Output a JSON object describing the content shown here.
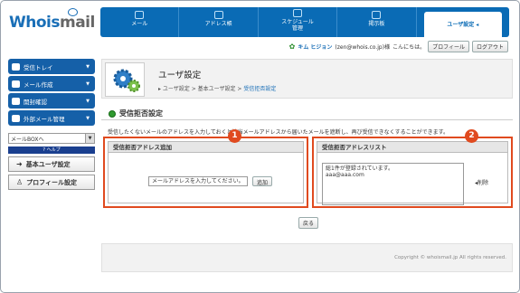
{
  "logo": {
    "part1": "Whois",
    "part2": "mail"
  },
  "nav": [
    {
      "label": "メール",
      "icon": "mail-icon"
    },
    {
      "label": "アドレス帳",
      "icon": "address-book-icon"
    },
    {
      "label": "スケジュール",
      "label2": "管理",
      "icon": "schedule-icon"
    },
    {
      "label": "掲示板",
      "icon": "board-icon"
    },
    {
      "label": "ユーザ設定 ◂",
      "icon": "settings-icon"
    }
  ],
  "userbar": {
    "name": "キム ヒジョン",
    "email": "(zen@whois.co.jp)様",
    "greeting": "こんにちは。",
    "profile": "プロフィール",
    "logout": "ログアウト"
  },
  "sidebar": {
    "menus": [
      "受信トレイ",
      "メール作成",
      "開封確認",
      "外部メール管理"
    ],
    "select": "メールBOXへ",
    "help": "ヘルプ",
    "btn_basic": "基本ユーザ設定",
    "btn_profile": "プロフィール設定"
  },
  "page": {
    "title": "ユーザ設定",
    "breadcrumb_prefix": "ユーザ設定 > 基本ユーザ設定 > ",
    "breadcrumb_current": "受信拒否設定",
    "section": "受信拒否設定",
    "desc": "受信したくないメールのアドレスを入力しておくと該当メールアドレスから届いたメールを遮断し、再び受信できなくすることができます。"
  },
  "panel1": {
    "header": "受信拒否アドレス追加",
    "placeholder": "メールアドレスを入力してください。",
    "add": "追加",
    "badge": "1"
  },
  "panel2": {
    "header": "受信拒否アドレスリスト",
    "line1": "総1件が登録されています。",
    "line2": "aaa@aaa.com",
    "del": "削除",
    "badge": "2"
  },
  "back": "戻る",
  "footer": "Copyright © whoismail.jp All rights reserved."
}
